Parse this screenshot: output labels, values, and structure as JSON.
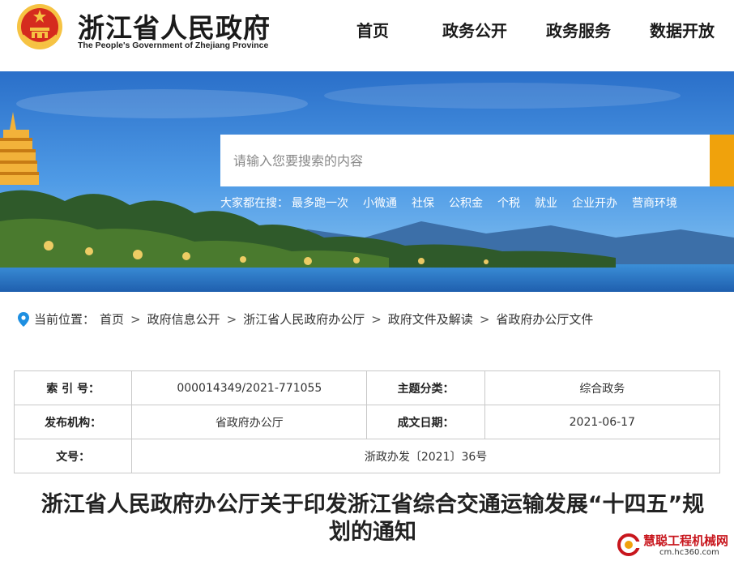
{
  "header": {
    "title": "浙江省人民政府",
    "subtitle": "The People's Government of Zhejiang Province",
    "emblem_icon": "national-emblem-icon",
    "nav": [
      "首页",
      "政务公开",
      "政务服务",
      "数据开放"
    ]
  },
  "banner": {
    "search_placeholder": "请输入您要搜索的内容",
    "search_button_color": "#f0a20c",
    "hot_label": "大家都在搜：",
    "hot_items": [
      "最多跑一次",
      "小微通",
      "社保",
      "公积金",
      "个税",
      "就业",
      "企业开办",
      "营商环境"
    ]
  },
  "breadcrumb": {
    "icon": "location-pin-icon",
    "label": "当前位置：",
    "items": [
      "首页",
      "政府信息公开",
      "浙江省人民政府办公厅",
      "政府文件及解读",
      "省政府办公厅文件"
    ],
    "separator": ">"
  },
  "info": {
    "index_label": "索 引 号：",
    "index_value": "000014349/2021-771055",
    "topic_label": "主题分类：",
    "topic_value": "综合政务",
    "issuer_label": "发布机构：",
    "issuer_value": "省政府办公厅",
    "date_label": "成文日期：",
    "date_value": "2021-06-17",
    "docno_label": "文号：",
    "docno_value": "浙政办发〔2021〕36号"
  },
  "article": {
    "title": "浙江省人民政府办公厅关于印发浙江省综合交通运输发展“十四五”规划的通知"
  },
  "watermark": {
    "name": "慧聪工程机械网",
    "url": "cm.hc360.com"
  },
  "colors": {
    "accent": "#f0a20c",
    "emblem_red": "#d52b1e",
    "emblem_gold": "#f6c343",
    "watermark_red": "#c8161d"
  }
}
